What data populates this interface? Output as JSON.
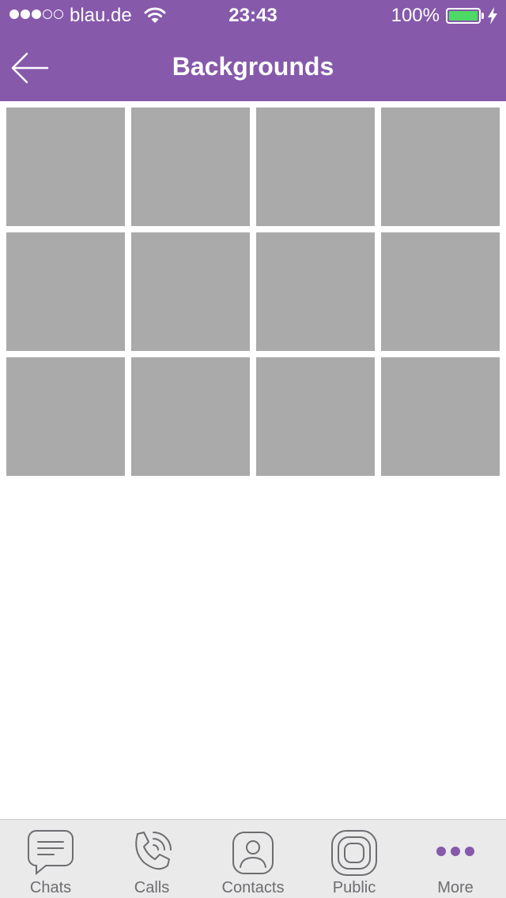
{
  "status_bar": {
    "carrier": "blau.de",
    "time": "23:43",
    "battery_percent": "100%",
    "battery_level": 1.0,
    "signal_bars_filled": 3,
    "signal_bars_total": 5
  },
  "header": {
    "title": "Backgrounds",
    "back_icon": "arrow-left-icon"
  },
  "backgrounds": {
    "tile_count": 12,
    "tile_color": "#aaaaaa"
  },
  "tab_bar": {
    "tabs": [
      {
        "label": "Chats",
        "icon": "chat-bubble-icon"
      },
      {
        "label": "Calls",
        "icon": "phone-icon"
      },
      {
        "label": "Contacts",
        "icon": "contact-icon"
      },
      {
        "label": "Public",
        "icon": "public-icon"
      },
      {
        "label": "More",
        "icon": "more-dots-icon"
      }
    ],
    "active_tab": "More"
  },
  "colors": {
    "accent": "#8659ab",
    "battery": "#4cd964",
    "tab_icon": "#6d6d72"
  }
}
